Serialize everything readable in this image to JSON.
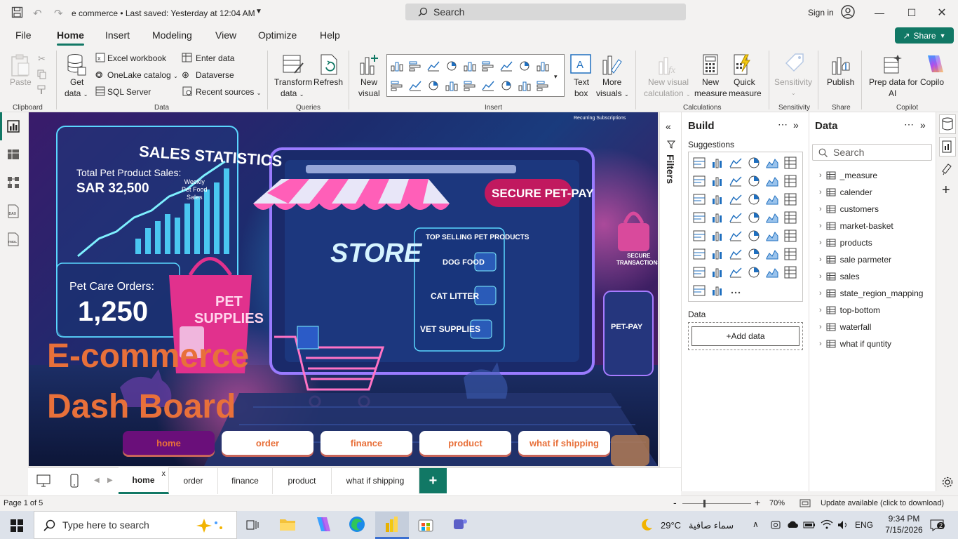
{
  "titlebar": {
    "doc_title": "e commerce • Last saved: Yesterday at 12:04 AM",
    "search_placeholder": "Search",
    "sign_in": "Sign in"
  },
  "menu": {
    "tabs": [
      "File",
      "Home",
      "Insert",
      "Modeling",
      "View",
      "Optimize",
      "Help"
    ],
    "active": "Home",
    "share": "Share"
  },
  "ribbon": {
    "clipboard": {
      "paste": "Paste",
      "group": "Clipboard"
    },
    "data": {
      "get_data": "Get",
      "get_data2": "data",
      "excel": "Excel workbook",
      "onelake": "OneLake catalog",
      "sql": "SQL Server",
      "enter_data": "Enter data",
      "dataverse": "Dataverse",
      "recent": "Recent sources",
      "group": "Data"
    },
    "queries": {
      "transform": "Transform",
      "transform2": "data",
      "refresh": "Refresh",
      "group": "Queries"
    },
    "insert": {
      "new_visual": "New",
      "new_visual2": "visual",
      "text_box": "Text",
      "text_box2": "box",
      "more_visuals": "More",
      "more_visuals2": "visuals",
      "group": "Insert"
    },
    "calculations": {
      "new_visual_calc": "New visual",
      "new_visual_calc2": "calculation",
      "new_measure": "New",
      "new_measure2": "measure",
      "quick_measure": "Quick",
      "quick_measure2": "measure",
      "group": "Calculations"
    },
    "sensitivity": {
      "label": "Sensitivity",
      "group": "Sensitivity"
    },
    "share": {
      "publish": "Publish",
      "group": "Share"
    },
    "copilot": {
      "prep": "Prep data for",
      "prep2": "AI",
      "copilot": "Copilo",
      "group": "Copilot"
    }
  },
  "report": {
    "sales_statistics": "SALES STATISTICS",
    "total_label": "Total Pet Product Sales:",
    "total_value": "SAR 32,500",
    "weekly": "Weekly",
    "pet_food": "Pet Food",
    "sales_word": "Sales",
    "orders_label": "Pet Care Orders:",
    "orders_value": "1,250",
    "pet_supplies": "PET",
    "pet_supplies2": "SUPPLIES",
    "store": "STORE",
    "top_selling": "TOP SELLING PET PRODUCTS",
    "dog_food": "DOG FOOD",
    "cat_litter": "CAT LITTER",
    "vet_supplies": "VET SUPPLIES",
    "secure_pay": "SECURE PET-PAY",
    "secure_tx": "SECURE",
    "secure_tx2": "TRANSACTIONS",
    "pet_pay": "PET-PAY",
    "recurring": "Recurring Subscriptions",
    "headline1": "E-commerce",
    "headline2": "Dash Board",
    "nav": [
      "home",
      "order",
      "finance",
      "product",
      "what if shipping"
    ]
  },
  "filters": {
    "label": "Filters"
  },
  "build": {
    "title": "Build",
    "suggestions": "Suggestions",
    "data_label": "Data",
    "add_data": "+Add data"
  },
  "data_pane": {
    "title": "Data",
    "search_placeholder": "Search",
    "tables": [
      "_measure",
      "calender",
      "customers",
      "market-basket",
      "products",
      "sale parmeter",
      "sales",
      "state_region_mapping",
      "top-bottom",
      "waterfall",
      "what if quntity"
    ]
  },
  "page_tabs": {
    "tabs": [
      "home",
      "order",
      "finance",
      "product",
      "what if shipping"
    ],
    "active": "home",
    "close": "x",
    "add": "+"
  },
  "status": {
    "page": "Page 1 of 5",
    "zoom_minus": "-",
    "zoom_plus": "+",
    "zoom": "70%",
    "update": "Update available (click to download)"
  },
  "taskbar": {
    "search_placeholder": "Type here to search",
    "temperature": "29°C",
    "weather": "سماء صافية",
    "lang": "ENG",
    "time": "9:34 PM",
    "date": "7/15/2026",
    "notifications": "2"
  },
  "colors": {
    "accent": "#117865",
    "headline": "#e8703a",
    "nav_active_bg": "#6a0f7a",
    "nav_text": "#e8703a"
  }
}
